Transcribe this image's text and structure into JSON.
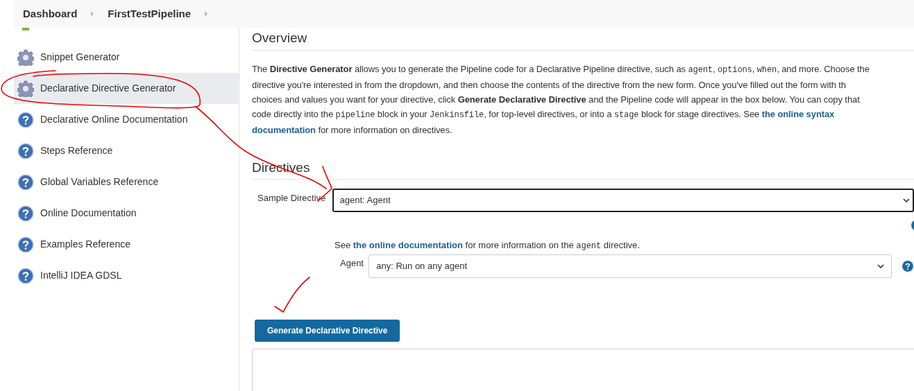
{
  "breadcrumbs": [
    {
      "label": "Dashboard"
    },
    {
      "label": "FirstTestPipeline"
    }
  ],
  "sidebar": {
    "items": [
      {
        "label": "Snippet Generator",
        "kind": "gear",
        "selected": false
      },
      {
        "label": "Declarative Directive Generator",
        "kind": "gear",
        "selected": true
      },
      {
        "label": "Declarative Online Documentation",
        "kind": "help",
        "selected": false
      },
      {
        "label": "Steps Reference",
        "kind": "help",
        "selected": false
      },
      {
        "label": "Global Variables Reference",
        "kind": "help",
        "selected": false
      },
      {
        "label": "Online Documentation",
        "kind": "help",
        "selected": false
      },
      {
        "label": "Examples Reference",
        "kind": "help",
        "selected": false
      },
      {
        "label": "IntelliJ IDEA GDSL",
        "kind": "help",
        "selected": false
      }
    ]
  },
  "overview": {
    "title": "Overview",
    "lines": [
      [
        {
          "kind": "text",
          "text": "The **Directive Generator** allows you to generate the Pipeline code for a Declarative Pipeline directive, such as "
        },
        {
          "kind": "code",
          "text": "agent"
        },
        {
          "kind": "text",
          "text": ", "
        },
        {
          "kind": "code",
          "text": "options"
        },
        {
          "kind": "text",
          "text": ", "
        },
        {
          "kind": "code",
          "text": "when"
        },
        {
          "kind": "text",
          "text": ", and more. Choose the"
        }
      ],
      [
        {
          "kind": "text",
          "text": "directive you're interested in from the dropdown, and then choose the contents of the directive from the new form. Once you've filled out the form with th"
        }
      ],
      [
        {
          "kind": "text",
          "text": "choices and values you want for your directive, click **Generate Declarative Directive** and the Pipeline code will appear in the box below. You can copy that"
        }
      ],
      [
        {
          "kind": "text",
          "text": "code directly into the "
        },
        {
          "kind": "code",
          "text": "pipeline"
        },
        {
          "kind": "text",
          "text": " block in your "
        },
        {
          "kind": "code",
          "text": "Jenkinsfile"
        },
        {
          "kind": "text",
          "text": ", for top-level directives, or into a "
        },
        {
          "kind": "code",
          "text": "stage"
        },
        {
          "kind": "text",
          "text": " block for stage directives. See "
        },
        {
          "kind": "link",
          "text": "the online syntax"
        }
      ],
      [
        {
          "kind": "link",
          "text": "documentation"
        },
        {
          "kind": "text",
          "text": " for more information on directives."
        }
      ]
    ]
  },
  "directives": {
    "title": "Directives",
    "sample_directive": {
      "label": "Sample Directive",
      "value": "agent: Agent"
    },
    "note": [
      {
        "kind": "text",
        "text": "See "
      },
      {
        "kind": "link",
        "text": "the online documentation"
      },
      {
        "kind": "text",
        "text": " for more information on the "
      },
      {
        "kind": "code",
        "text": "agent"
      },
      {
        "kind": "text",
        "text": " directive."
      }
    ],
    "agent": {
      "label": "Agent",
      "value": "any: Run on any agent"
    },
    "button": "Generate Declarative Directive"
  }
}
